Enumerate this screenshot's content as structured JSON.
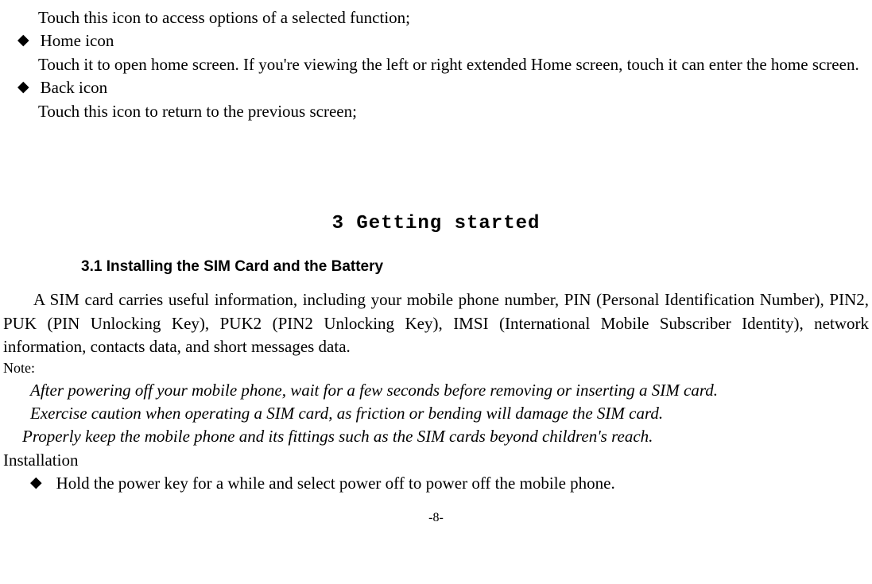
{
  "top": {
    "line1": "Touch this icon to access options of a selected function;",
    "bullet1": "Home icon",
    "bullet1_desc": "Touch it to open home screen. If you're viewing the left or right extended Home screen, touch it can enter the home screen.",
    "bullet2": "Back icon",
    "bullet2_desc": "Touch this icon to return to the previous screen;"
  },
  "section": {
    "title": "3 Getting started",
    "subsection": "3.1    Installing the SIM Card and the Battery",
    "para": "A SIM card carries useful information, including your mobile phone number, PIN (Personal Identification Number), PIN2, PUK (PIN Unlocking Key), PUK2 (PIN2 Unlocking Key), IMSI (International Mobile Subscriber Identity), network information, contacts data, and short messages data.",
    "note_label": "Note:",
    "note1": "After powering off your mobile phone, wait for a few seconds before removing or inserting a SIM card.",
    "note2": "Exercise caution when operating a SIM card, as friction or bending will damage the SIM card.",
    "note3": "Properly keep the mobile phone and its fittings such as the SIM cards beyond children's reach.",
    "install_label": "Installation",
    "install_bullet": "Hold the power key for a while and select power off to power off the mobile phone."
  },
  "page": "-8-",
  "icons": {
    "diamond": "◆"
  }
}
